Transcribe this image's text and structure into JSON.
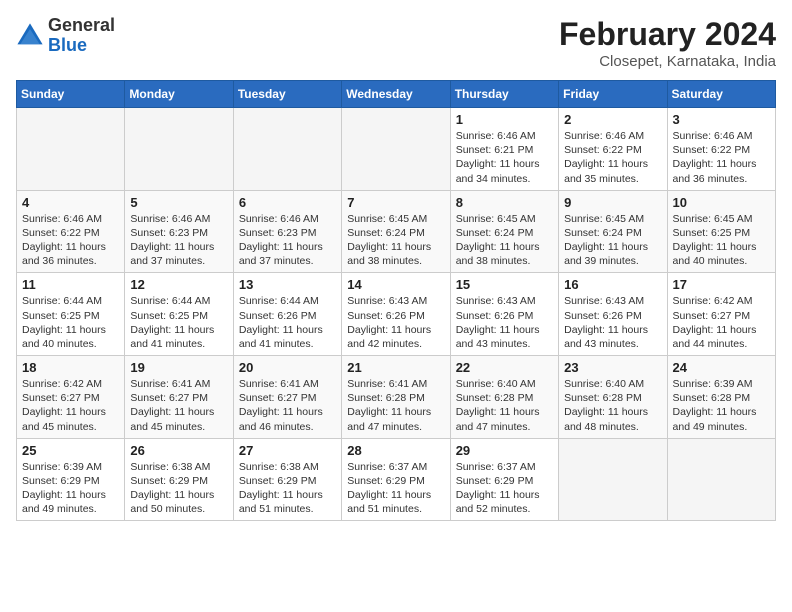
{
  "app": {
    "name_general": "General",
    "name_blue": "Blue"
  },
  "title": "February 2024",
  "subtitle": "Closepet, Karnataka, India",
  "days_of_week": [
    "Sunday",
    "Monday",
    "Tuesday",
    "Wednesday",
    "Thursday",
    "Friday",
    "Saturday"
  ],
  "weeks": [
    [
      {
        "day": "",
        "info": ""
      },
      {
        "day": "",
        "info": ""
      },
      {
        "day": "",
        "info": ""
      },
      {
        "day": "",
        "info": ""
      },
      {
        "day": "1",
        "info": "Sunrise: 6:46 AM\nSunset: 6:21 PM\nDaylight: 11 hours\nand 34 minutes."
      },
      {
        "day": "2",
        "info": "Sunrise: 6:46 AM\nSunset: 6:22 PM\nDaylight: 11 hours\nand 35 minutes."
      },
      {
        "day": "3",
        "info": "Sunrise: 6:46 AM\nSunset: 6:22 PM\nDaylight: 11 hours\nand 36 minutes."
      }
    ],
    [
      {
        "day": "4",
        "info": "Sunrise: 6:46 AM\nSunset: 6:22 PM\nDaylight: 11 hours\nand 36 minutes."
      },
      {
        "day": "5",
        "info": "Sunrise: 6:46 AM\nSunset: 6:23 PM\nDaylight: 11 hours\nand 37 minutes."
      },
      {
        "day": "6",
        "info": "Sunrise: 6:46 AM\nSunset: 6:23 PM\nDaylight: 11 hours\nand 37 minutes."
      },
      {
        "day": "7",
        "info": "Sunrise: 6:45 AM\nSunset: 6:24 PM\nDaylight: 11 hours\nand 38 minutes."
      },
      {
        "day": "8",
        "info": "Sunrise: 6:45 AM\nSunset: 6:24 PM\nDaylight: 11 hours\nand 38 minutes."
      },
      {
        "day": "9",
        "info": "Sunrise: 6:45 AM\nSunset: 6:24 PM\nDaylight: 11 hours\nand 39 minutes."
      },
      {
        "day": "10",
        "info": "Sunrise: 6:45 AM\nSunset: 6:25 PM\nDaylight: 11 hours\nand 40 minutes."
      }
    ],
    [
      {
        "day": "11",
        "info": "Sunrise: 6:44 AM\nSunset: 6:25 PM\nDaylight: 11 hours\nand 40 minutes."
      },
      {
        "day": "12",
        "info": "Sunrise: 6:44 AM\nSunset: 6:25 PM\nDaylight: 11 hours\nand 41 minutes."
      },
      {
        "day": "13",
        "info": "Sunrise: 6:44 AM\nSunset: 6:26 PM\nDaylight: 11 hours\nand 41 minutes."
      },
      {
        "day": "14",
        "info": "Sunrise: 6:43 AM\nSunset: 6:26 PM\nDaylight: 11 hours\nand 42 minutes."
      },
      {
        "day": "15",
        "info": "Sunrise: 6:43 AM\nSunset: 6:26 PM\nDaylight: 11 hours\nand 43 minutes."
      },
      {
        "day": "16",
        "info": "Sunrise: 6:43 AM\nSunset: 6:26 PM\nDaylight: 11 hours\nand 43 minutes."
      },
      {
        "day": "17",
        "info": "Sunrise: 6:42 AM\nSunset: 6:27 PM\nDaylight: 11 hours\nand 44 minutes."
      }
    ],
    [
      {
        "day": "18",
        "info": "Sunrise: 6:42 AM\nSunset: 6:27 PM\nDaylight: 11 hours\nand 45 minutes."
      },
      {
        "day": "19",
        "info": "Sunrise: 6:41 AM\nSunset: 6:27 PM\nDaylight: 11 hours\nand 45 minutes."
      },
      {
        "day": "20",
        "info": "Sunrise: 6:41 AM\nSunset: 6:27 PM\nDaylight: 11 hours\nand 46 minutes."
      },
      {
        "day": "21",
        "info": "Sunrise: 6:41 AM\nSunset: 6:28 PM\nDaylight: 11 hours\nand 47 minutes."
      },
      {
        "day": "22",
        "info": "Sunrise: 6:40 AM\nSunset: 6:28 PM\nDaylight: 11 hours\nand 47 minutes."
      },
      {
        "day": "23",
        "info": "Sunrise: 6:40 AM\nSunset: 6:28 PM\nDaylight: 11 hours\nand 48 minutes."
      },
      {
        "day": "24",
        "info": "Sunrise: 6:39 AM\nSunset: 6:28 PM\nDaylight: 11 hours\nand 49 minutes."
      }
    ],
    [
      {
        "day": "25",
        "info": "Sunrise: 6:39 AM\nSunset: 6:29 PM\nDaylight: 11 hours\nand 49 minutes."
      },
      {
        "day": "26",
        "info": "Sunrise: 6:38 AM\nSunset: 6:29 PM\nDaylight: 11 hours\nand 50 minutes."
      },
      {
        "day": "27",
        "info": "Sunrise: 6:38 AM\nSunset: 6:29 PM\nDaylight: 11 hours\nand 51 minutes."
      },
      {
        "day": "28",
        "info": "Sunrise: 6:37 AM\nSunset: 6:29 PM\nDaylight: 11 hours\nand 51 minutes."
      },
      {
        "day": "29",
        "info": "Sunrise: 6:37 AM\nSunset: 6:29 PM\nDaylight: 11 hours\nand 52 minutes."
      },
      {
        "day": "",
        "info": ""
      },
      {
        "day": "",
        "info": ""
      }
    ]
  ]
}
